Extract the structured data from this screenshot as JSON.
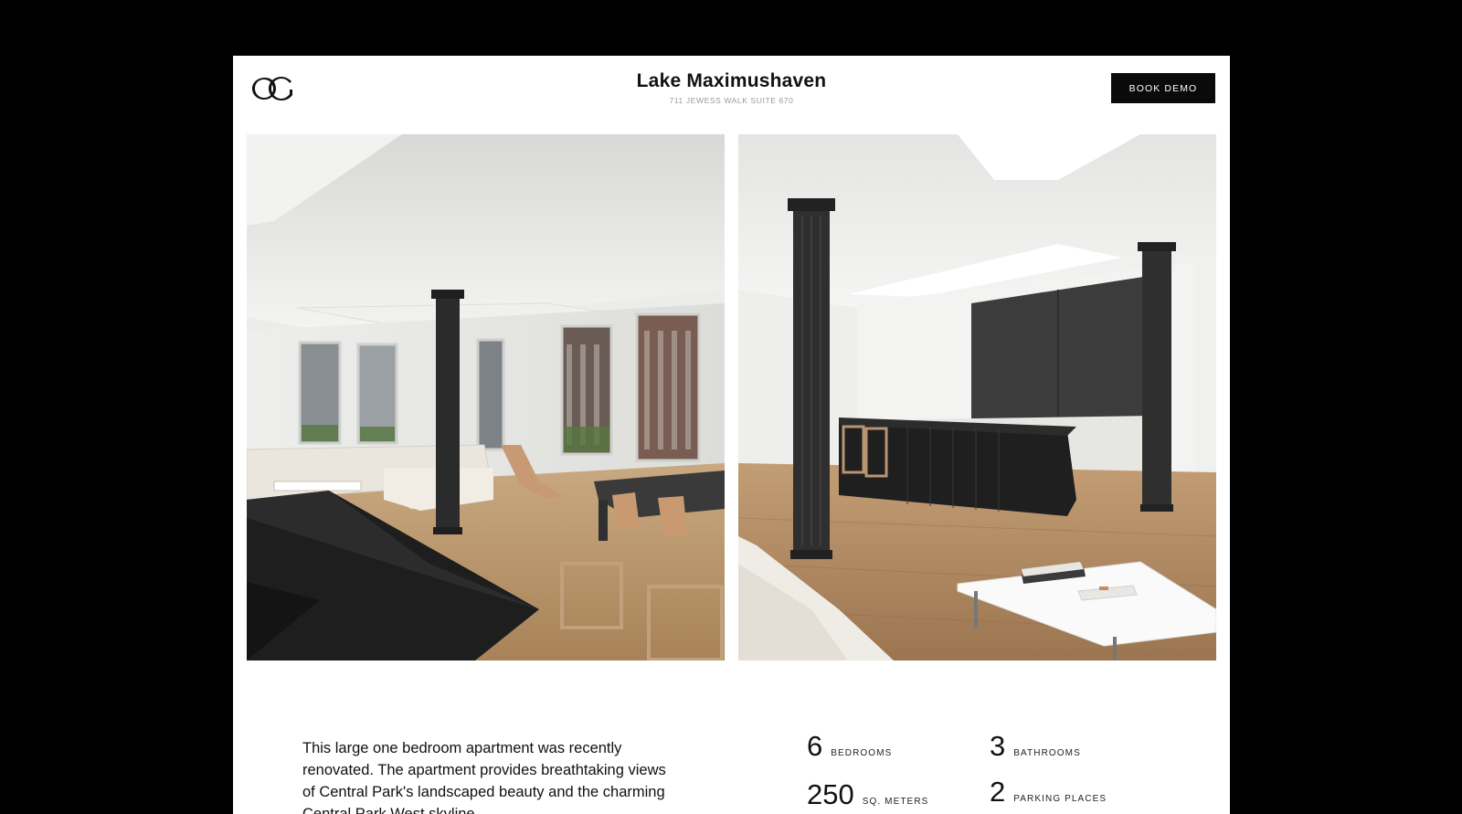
{
  "header": {
    "logo_text": "OC",
    "title": "Lake Maximushaven",
    "address": "711 Jewess Walk Suite 670",
    "book_demo_label": "BOOK DEMO"
  },
  "photos": [
    {
      "name": "living-room-photo",
      "subject": "loft living room with cast-iron column and large windows"
    },
    {
      "name": "kitchen-photo",
      "subject": "open kitchen with dark island and cast-iron columns"
    }
  ],
  "description": "This large one bedroom apartment was recently renovated. The apartment provides breathtaking views of Central Park's landscaped beauty and the charming Central Park West skyline.",
  "stats": [
    {
      "value": "6",
      "label": "BEDROOMS"
    },
    {
      "value": "3",
      "label": "BATHROOMS"
    },
    {
      "value": "250",
      "label": "SQ. METERS"
    },
    {
      "value": "2",
      "label": "PARKING PLACES"
    }
  ],
  "colors": {
    "background": "#000000",
    "page": "#ffffff",
    "button": "#0a0a0a",
    "text": "#111111",
    "muted": "#9a9a9a"
  }
}
